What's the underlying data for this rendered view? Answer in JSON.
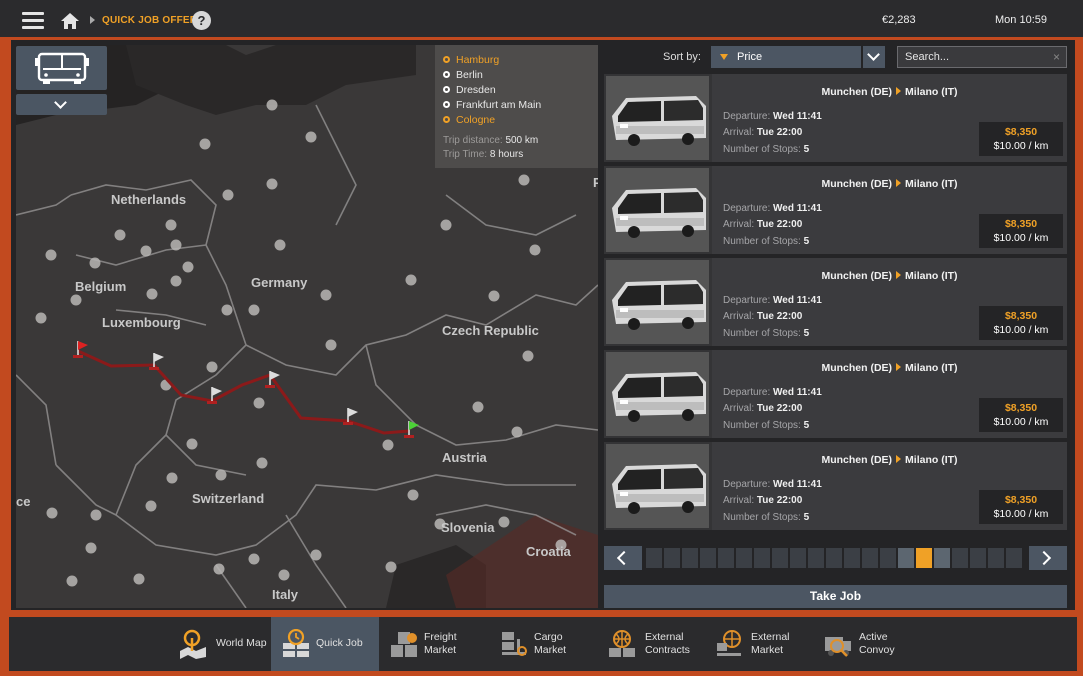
{
  "header": {
    "breadcrumb": "QUICK JOB OFFERS",
    "help": "?",
    "money": "€2,283",
    "time": "Mon 10:59"
  },
  "map": {
    "countries": [
      "Netherlands",
      "Belgium",
      "Luxembourg",
      "Germany",
      "Czech Republic",
      "Austria",
      "Switzerland",
      "Slovenia",
      "Croatia",
      "Italy",
      "ce",
      "P"
    ],
    "route_stops": [
      {
        "name": "Hamburg",
        "highlighted": true
      },
      {
        "name": "Berlin",
        "highlighted": false
      },
      {
        "name": "Dresden",
        "highlighted": false
      },
      {
        "name": "Frankfurt am Main",
        "highlighted": false
      },
      {
        "name": "Cologne",
        "highlighted": true
      }
    ],
    "trip_distance_label": "Trip distance:",
    "trip_distance": "500 km",
    "trip_time_label": "Trip Time:",
    "trip_time": "8 hours",
    "route_color": "#8b1a1a"
  },
  "sort": {
    "label": "Sort by:",
    "value": "Price"
  },
  "search": {
    "placeholder": "Search...",
    "clear": "×"
  },
  "jobs": [
    {
      "from": "Munchen (DE)",
      "to": "Milano (IT)",
      "departure_label": "Departure:",
      "departure": "Wed 11:41",
      "arrival_label": "Arrival:",
      "arrival": "Tue 22:00",
      "stops_label": "Number of Stops:",
      "stops": "5",
      "price": "$8,350",
      "rate": "$10.00 / km"
    },
    {
      "from": "Munchen (DE)",
      "to": "Milano (IT)",
      "departure_label": "Departure:",
      "departure": "Wed 11:41",
      "arrival_label": "Arrival:",
      "arrival": "Tue 22:00",
      "stops_label": "Number of Stops:",
      "stops": "5",
      "price": "$8,350",
      "rate": "$10.00 / km"
    },
    {
      "from": "Munchen (DE)",
      "to": "Milano (IT)",
      "departure_label": "Departure:",
      "departure": "Wed 11:41",
      "arrival_label": "Arrival:",
      "arrival": "Tue 22:00",
      "stops_label": "Number of Stops:",
      "stops": "5",
      "price": "$8,350",
      "rate": "$10.00 / km"
    },
    {
      "from": "Munchen (DE)",
      "to": "Milano (IT)",
      "departure_label": "Departure:",
      "departure": "Wed 11:41",
      "arrival_label": "Arrival:",
      "arrival": "Tue 22:00",
      "stops_label": "Number of Stops:",
      "stops": "5",
      "price": "$8,350",
      "rate": "$10.00 / km"
    },
    {
      "from": "Munchen (DE)",
      "to": "Milano (IT)",
      "departure_label": "Departure:",
      "departure": "Wed 11:41",
      "arrival_label": "Arrival:",
      "arrival": "Tue 22:00",
      "stops_label": "Number of Stops:",
      "stops": "5",
      "price": "$8,350",
      "rate": "$10.00 / km"
    }
  ],
  "pager": {
    "current_page": 16,
    "total_pages": 21
  },
  "take_job": "Take Job",
  "bottom_tabs": [
    {
      "label": "World Map",
      "icon": "world-map-icon",
      "active": false
    },
    {
      "label": "Quick Job",
      "icon": "quick-job-icon",
      "active": true
    },
    {
      "label": "Freight\nMarket",
      "icon": "freight-market-icon",
      "active": false
    },
    {
      "label": "Cargo\nMarket",
      "icon": "cargo-market-icon",
      "active": false
    },
    {
      "label": "External\nContracts",
      "icon": "external-contracts-icon",
      "active": false
    },
    {
      "label": "External\nMarket",
      "icon": "external-market-icon",
      "active": false
    },
    {
      "label": "Active\nConvoy",
      "icon": "active-convoy-icon",
      "active": false
    }
  ],
  "colors": {
    "accent": "#f0a126",
    "frame": "#c24a1f",
    "button": "#4c5663"
  }
}
